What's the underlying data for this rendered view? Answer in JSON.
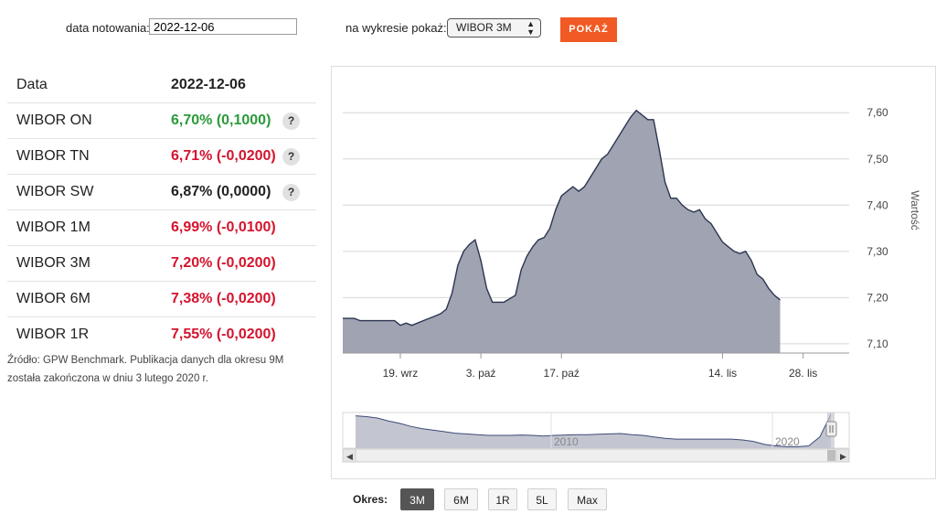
{
  "controls": {
    "date_label": "data notowania:",
    "date_value": "2022-12-06",
    "chart_label": "na wykresie pokaż:",
    "chart_select": "WIBOR 3M",
    "show_button": "POKAŻ"
  },
  "table": {
    "header": {
      "name": "Data",
      "value": "2022-12-06"
    },
    "rows": [
      {
        "name": "WIBOR ON",
        "value": "6,70% (0,1000)",
        "color": "#2b9a3a",
        "help": "?"
      },
      {
        "name": "WIBOR TN",
        "value": "6,71% (-0,0200)",
        "color": "#d4142e",
        "help": "?"
      },
      {
        "name": "WIBOR SW",
        "value": "6,87% (0,0000)",
        "color": "#222222",
        "help": "?"
      },
      {
        "name": "WIBOR 1M",
        "value": "6,99% (-0,0100)",
        "color": "#d4142e"
      },
      {
        "name": "WIBOR 3M",
        "value": "7,20% (-0,0200)",
        "color": "#d4142e"
      },
      {
        "name": "WIBOR 6M",
        "value": "7,38% (-0,0200)",
        "color": "#d4142e"
      },
      {
        "name": "WIBOR 1R",
        "value": "7,55% (-0,0200)",
        "color": "#d4142e"
      }
    ],
    "source_note": "Źródło: GPW Benchmark. Publikacja danych dla okresu 9M została zakończona w dniu 3 lutego 2020 r."
  },
  "chart_data": {
    "type": "area",
    "ylabel": "Wartość",
    "ylim": [
      7.08,
      7.64
    ],
    "y_ticks": [
      "7,10",
      "7,20",
      "7,30",
      "7,40",
      "7,50",
      "7,60"
    ],
    "x_ticks": [
      {
        "label": "19. wrz",
        "day": 19
      },
      {
        "label": "3. paź",
        "day": 33
      },
      {
        "label": "17. paź",
        "day": 47
      },
      {
        "label": "14. lis",
        "day": 75
      },
      {
        "label": "28. lis",
        "day": 89
      }
    ],
    "x_range": [
      9,
      97
    ],
    "series": [
      {
        "values": [
          [
            9,
            7.155
          ],
          [
            11,
            7.155
          ],
          [
            12,
            7.15
          ],
          [
            18,
            7.15
          ],
          [
            19,
            7.14
          ],
          [
            20,
            7.145
          ],
          [
            21,
            7.14
          ],
          [
            23,
            7.15
          ],
          [
            24,
            7.155
          ],
          [
            25,
            7.16
          ],
          [
            26,
            7.165
          ],
          [
            27,
            7.175
          ],
          [
            28,
            7.21
          ],
          [
            29,
            7.27
          ],
          [
            30,
            7.3
          ],
          [
            31,
            7.315
          ],
          [
            32,
            7.325
          ],
          [
            33,
            7.28
          ],
          [
            34,
            7.22
          ],
          [
            35,
            7.19
          ],
          [
            36,
            7.19
          ],
          [
            37,
            7.19
          ],
          [
            39,
            7.205
          ],
          [
            40,
            7.26
          ],
          [
            41,
            7.29
          ],
          [
            42,
            7.31
          ],
          [
            43,
            7.325
          ],
          [
            44,
            7.33
          ],
          [
            45,
            7.35
          ],
          [
            46,
            7.39
          ],
          [
            47,
            7.42
          ],
          [
            48,
            7.43
          ],
          [
            49,
            7.44
          ],
          [
            50,
            7.43
          ],
          [
            51,
            7.44
          ],
          [
            52,
            7.46
          ],
          [
            53,
            7.48
          ],
          [
            54,
            7.5
          ],
          [
            55,
            7.51
          ],
          [
            56,
            7.53
          ],
          [
            57,
            7.55
          ],
          [
            58,
            7.57
          ],
          [
            59,
            7.59
          ],
          [
            60,
            7.605
          ],
          [
            61,
            7.595
          ],
          [
            62,
            7.585
          ],
          [
            63,
            7.585
          ],
          [
            64,
            7.52
          ],
          [
            65,
            7.45
          ],
          [
            66,
            7.415
          ],
          [
            67,
            7.415
          ],
          [
            68,
            7.4
          ],
          [
            69,
            7.39
          ],
          [
            70,
            7.385
          ],
          [
            71,
            7.39
          ],
          [
            72,
            7.37
          ],
          [
            73,
            7.36
          ],
          [
            74,
            7.34
          ],
          [
            75,
            7.32
          ],
          [
            76,
            7.31
          ],
          [
            77,
            7.3
          ],
          [
            78,
            7.295
          ],
          [
            79,
            7.3
          ],
          [
            80,
            7.28
          ],
          [
            81,
            7.25
          ],
          [
            82,
            7.24
          ],
          [
            83,
            7.22
          ],
          [
            84,
            7.205
          ],
          [
            85,
            7.195
          ]
        ]
      }
    ],
    "navigator": {
      "labels": [
        "2010",
        "2020"
      ],
      "values": [
        4.3,
        4.2,
        4.0,
        3.6,
        3.3,
        2.9,
        2.6,
        2.4,
        2.2,
        2.0,
        1.9,
        1.8,
        1.7,
        1.7,
        1.7,
        1.75,
        1.7,
        1.6,
        1.7,
        1.75,
        1.8,
        1.8,
        1.85,
        1.9,
        1.95,
        1.8,
        1.7,
        1.5,
        1.3,
        1.2,
        1.2,
        1.2,
        1.2,
        1.2,
        1.2,
        1.1,
        0.9,
        0.5,
        0.3,
        0.2,
        0.2,
        0.3,
        1.5,
        4.5
      ]
    }
  },
  "period": {
    "label": "Okres:",
    "buttons": [
      "3M",
      "6M",
      "1R",
      "5L",
      "Max"
    ],
    "active": "3M"
  }
}
